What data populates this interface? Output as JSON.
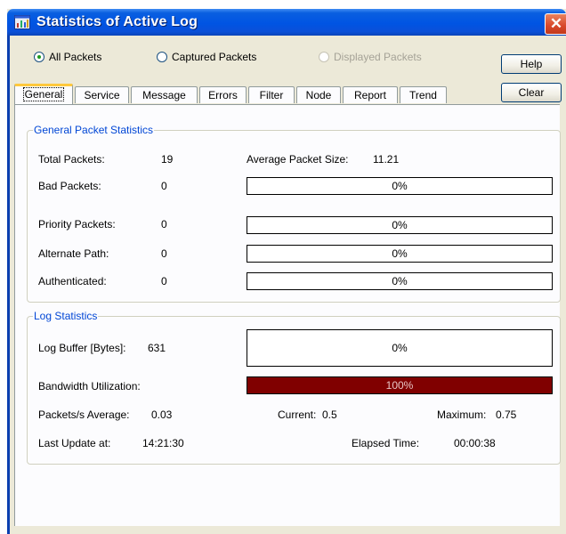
{
  "window": {
    "title": "Statistics of Active Log",
    "close_glyph": "✕"
  },
  "filter": {
    "options": [
      {
        "label": "All Packets",
        "selected": true,
        "enabled": true
      },
      {
        "label": "Captured Packets",
        "selected": false,
        "enabled": true
      },
      {
        "label": "Displayed Packets",
        "selected": false,
        "enabled": false
      }
    ]
  },
  "buttons": {
    "help": "Help",
    "clear": "Clear"
  },
  "tabs": [
    "General",
    "Service",
    "Message",
    "Errors",
    "Filter",
    "Node",
    "Report",
    "Trend"
  ],
  "active_tab": "General",
  "general": {
    "title": "General Packet Statistics",
    "total_label": "Total Packets:",
    "total_value": "19",
    "avg_label": "Average Packet Size:",
    "avg_value": "11.21",
    "bad_label": "Bad Packets:",
    "bad_value": "0",
    "bad_pct": "0%",
    "bad_fraction": 0,
    "priority_label": "Priority Packets:",
    "priority_value": "0",
    "priority_pct": "0%",
    "priority_fraction": 0,
    "alternate_label": "Alternate Path:",
    "alternate_value": "0",
    "alternate_pct": "0%",
    "alternate_fraction": 0,
    "auth_label": "Authenticated:",
    "auth_value": "0",
    "auth_pct": "0%",
    "auth_fraction": 0
  },
  "log": {
    "title": "Log Statistics",
    "buffer_label": "Log Buffer [Bytes]:",
    "buffer_value": "631",
    "buffer_pct": "0%",
    "buffer_fraction": 0,
    "bandwidth_label": "Bandwidth Utilization:",
    "bandwidth_pct": "100%",
    "bandwidth_fraction": 1,
    "pps_avg_label": "Packets/s Average:",
    "pps_avg_value": "0.03",
    "current_label": "Current:",
    "current_value": "0.5",
    "max_label": "Maximum:",
    "max_value": "0.75",
    "last_update_label": "Last Update at:",
    "last_update_value": "14:21:30",
    "elapsed_label": "Elapsed Time:",
    "elapsed_value": "00:00:38"
  },
  "colors": {
    "title_bar": "#0054e3",
    "group_title": "#0046d5",
    "bar_fill": "#800000",
    "active_tab_accent": "#ffc83c"
  }
}
